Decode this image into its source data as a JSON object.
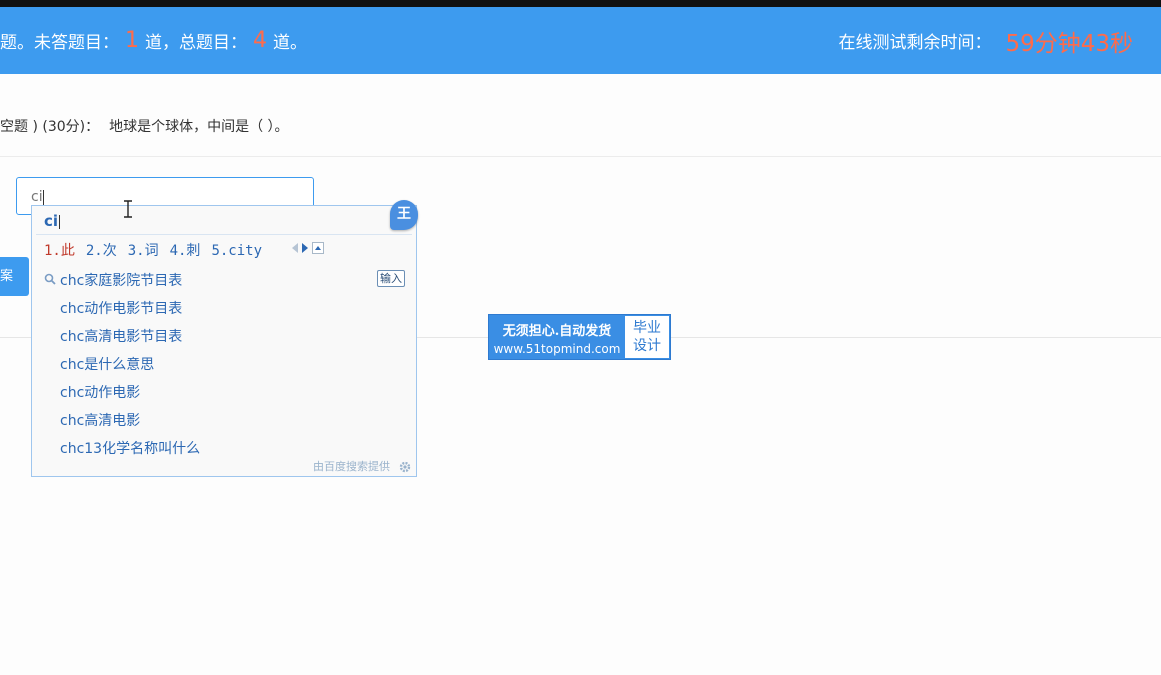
{
  "header": {
    "status_prefix": "题。未答题目：",
    "unanswered": "1",
    "status_mid": "道，总题目：",
    "total": "4",
    "status_suffix": "道。",
    "timer_label": "在线测试剩余时间：",
    "timer_value": "59分钟43秒"
  },
  "question": {
    "type_score": "空题 ) (30分)：",
    "text": "地球是个球体，中间是（ ）。"
  },
  "answer_input": {
    "value": "ci"
  },
  "side_button": {
    "label": "案"
  },
  "ime": {
    "composition": "ci",
    "logo": "王",
    "candidates": [
      "1.此",
      "2.次",
      "3.词",
      "4.刺",
      "5.city"
    ],
    "enter_label": "输入",
    "suggestions": [
      "chc家庭影院节目表",
      "chc动作电影节目表",
      "chc高清电影节目表",
      "chc是什么意思",
      "chc动作电影",
      "chc高清电影",
      "chc13化学名称叫什么"
    ],
    "footer": "由百度搜索提供"
  },
  "watermark": {
    "line1": "无须担心.自动发货",
    "line2": "www.51topmind.com",
    "side_line1": "毕业",
    "side_line2": "设计"
  },
  "colors": {
    "accent": "#3d9bef",
    "highlight": "#ff6b4a",
    "ime_text": "#2c68b3"
  }
}
